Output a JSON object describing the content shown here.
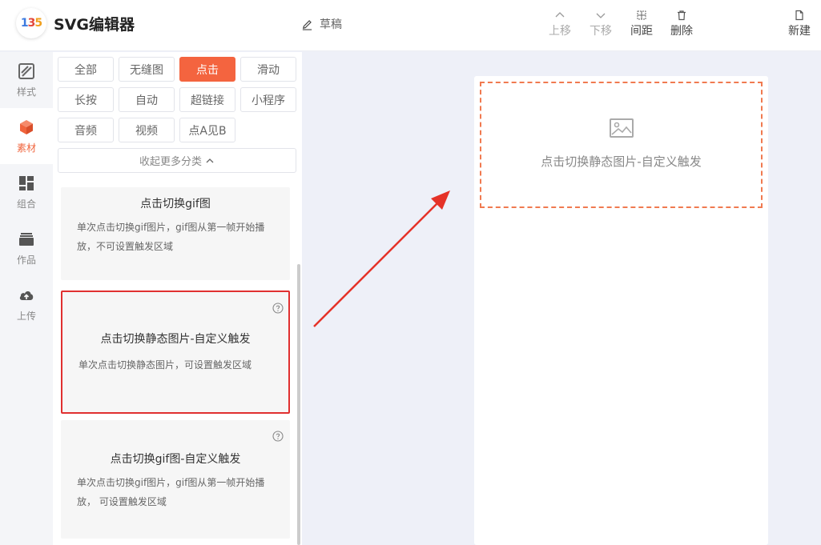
{
  "header": {
    "logo_text": [
      "1",
      "3",
      "5"
    ],
    "title": "SVG编辑器",
    "draft_label": "草稿",
    "tools": [
      {
        "label": "上移",
        "icon": "chevron-up-icon"
      },
      {
        "label": "下移",
        "icon": "chevron-down-icon"
      },
      {
        "label": "间距",
        "icon": "spacing-icon"
      },
      {
        "label": "删除",
        "icon": "trash-icon"
      }
    ],
    "new_label": "新建"
  },
  "sidebar": {
    "items": [
      {
        "label": "样式",
        "icon": "style-icon"
      },
      {
        "label": "素材",
        "icon": "cube-icon",
        "active": true
      },
      {
        "label": "组合",
        "icon": "grid-icon"
      },
      {
        "label": "作品",
        "icon": "folder-icon"
      },
      {
        "label": "上传",
        "icon": "cloud-upload-icon"
      }
    ]
  },
  "categories": {
    "items": [
      "全部",
      "无缝图",
      "点击",
      "滑动",
      "长按",
      "自动",
      "超链接",
      "小程序",
      "音频",
      "视频",
      "点A见B"
    ],
    "active": "点击",
    "collapse_label": "收起更多分类"
  },
  "components": [
    {
      "title": "点击切换gif图",
      "desc": "单次点击切换gif图片，gif图从第一帧开始播放，不可设置触发区域"
    },
    {
      "title": "点击切换静态图片-自定义触发",
      "desc": "单次点击切换静态图片，可设置触发区域"
    },
    {
      "title": "点击切换gif图-自定义触发",
      "desc": "单次点击切换gif图片，gif图从第一帧开始播放， 可设置触发区域"
    }
  ],
  "canvas": {
    "placeholder_text": "点击切换静态图片-自定义触发"
  },
  "colors": {
    "accent": "#f4643f",
    "highlight": "#e03030"
  }
}
